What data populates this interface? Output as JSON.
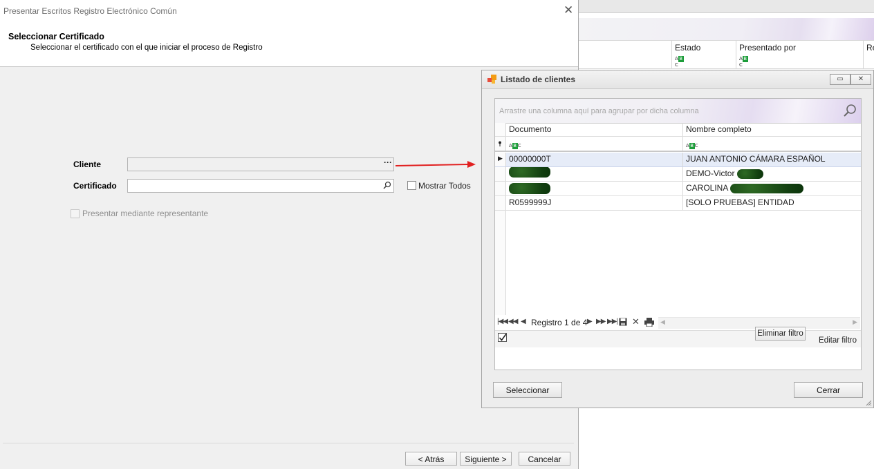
{
  "colors": {
    "accent_arrow": "#e12020",
    "abc_green": "#1d9d3a",
    "selected_row": "#e6ecf8"
  },
  "background_grid": {
    "columns": [
      "Estado",
      "Presentado por",
      "Re"
    ],
    "filter_icon": "abc-filter-icon"
  },
  "wizard": {
    "title": "Presentar Escritos Registro Electrónico Común",
    "close_icon": "close-icon",
    "heading": "Seleccionar Certificado",
    "subheading": "Seleccionar el certificado con el que iniciar el proceso de Registro",
    "cliente_label": "Cliente",
    "cliente_value": "",
    "cliente_button": "···",
    "certificado_label": "Certificado",
    "certificado_value": "",
    "mostrar_todos_label": "Mostrar Todos",
    "representante_label": "Presentar mediante representante",
    "back_button": "< Atrás",
    "next_button": "Siguiente >",
    "cancel_button": "Cancelar"
  },
  "dialog": {
    "title": "Listado de clientes",
    "restore_icon": "restore-icon",
    "close_icon": "close-icon",
    "group_hint": "Arrastre una columna aquí para agrupar por dicha columna",
    "columns": [
      "Documento",
      "Nombre completo"
    ],
    "rows": [
      {
        "documento": "00000000T",
        "nombre": "JUAN ANTONIO CÁMARA ESPAÑOL",
        "selected": true
      },
      {
        "documento": "",
        "nombre": "DEMO-Victor",
        "selected": false
      },
      {
        "documento": "",
        "nombre": "CAROLINA",
        "selected": false
      },
      {
        "documento": "R0599999J",
        "nombre": "[SOLO PRUEBAS] ENTIDAD",
        "selected": false
      }
    ],
    "pager_text": "Registro 1 de 4",
    "remove_filter_button": "Eliminar filtro",
    "edit_filter_link": "Editar filtro",
    "select_button": "Seleccionar",
    "close_button": "Cerrar"
  }
}
